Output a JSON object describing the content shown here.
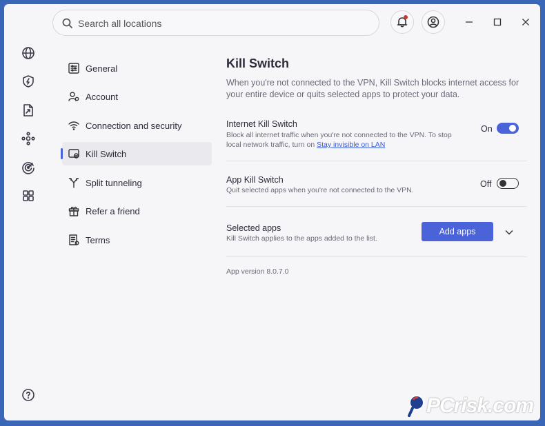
{
  "search": {
    "placeholder": "Search all locations"
  },
  "rail": {
    "items": [
      "globe-icon",
      "shield-bolt-icon",
      "file-share-icon",
      "mesh-network-icon",
      "radar-icon",
      "apps-grid-icon"
    ],
    "bottom": "help-icon"
  },
  "header": {
    "notifications": "bell-icon",
    "profile": "user-icon"
  },
  "window_controls": [
    "minimize",
    "maximize",
    "close"
  ],
  "nav": {
    "items": [
      {
        "label": "General",
        "icon": "sliders-icon"
      },
      {
        "label": "Account",
        "icon": "account-icon"
      },
      {
        "label": "Connection and security",
        "icon": "wifi-icon"
      },
      {
        "label": "Kill Switch",
        "icon": "kill-switch-icon",
        "active": true
      },
      {
        "label": "Split tunneling",
        "icon": "split-icon"
      },
      {
        "label": "Refer a friend",
        "icon": "gift-icon"
      },
      {
        "label": "Terms",
        "icon": "document-icon"
      }
    ]
  },
  "main": {
    "title": "Kill Switch",
    "description": "When you're not connected to the VPN, Kill Switch blocks internet access for your entire device or quits selected apps to protect your data.",
    "internet": {
      "title": "Internet Kill Switch",
      "desc_line1": "Block all internet traffic when you're not connected to the VPN. To stop",
      "desc_line2": "local network traffic, turn on ",
      "link": "Stay invisible on LAN",
      "state": "On"
    },
    "app": {
      "title": "App Kill Switch",
      "desc": "Quit selected apps when you're not connected to the VPN.",
      "state": "Off"
    },
    "selected": {
      "title": "Selected apps",
      "desc": "Kill Switch applies to the apps added to the list.",
      "button": "Add apps"
    },
    "version": "App version 8.0.7.0"
  },
  "watermark": {
    "text": "PCrisk.com"
  },
  "colors": {
    "accent": "#4a63d8",
    "background": "#f6f6f8",
    "frame": "#3a66b8"
  }
}
